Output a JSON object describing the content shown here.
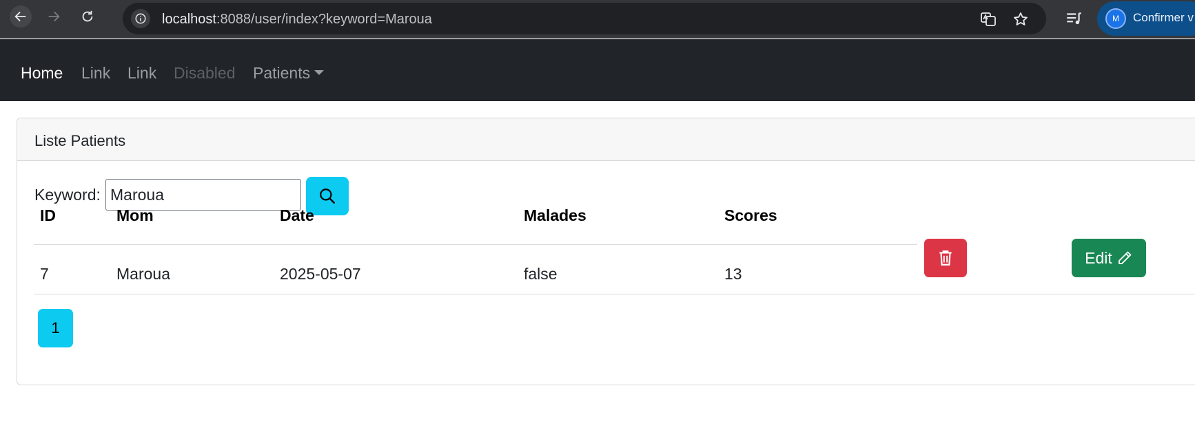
{
  "browser": {
    "url_host": "localhost",
    "url_path": ":8088/user/index?keyword=Maroua",
    "profile_initial": "M",
    "profile_label": "Confirmer v",
    "icons": [
      "back-arrow-icon",
      "forward-arrow-icon",
      "reload-icon",
      "info-icon",
      "translate-icon",
      "star-icon",
      "media-queue-icon"
    ]
  },
  "navbar": {
    "home": "Home",
    "link1": "Link",
    "link2": "Link",
    "disabled": "Disabled",
    "patients": "Patients"
  },
  "card": {
    "title": "Liste Patients"
  },
  "search": {
    "label": "Keyword:",
    "value": "Maroua"
  },
  "table": {
    "headers": [
      "ID",
      "Mom",
      "Date",
      "Malades",
      "Scores"
    ],
    "rows": [
      {
        "id": "7",
        "nom": "Maroua",
        "date": "2025-05-07",
        "malade": "false",
        "score": "13"
      }
    ],
    "edit_label": "Edit"
  },
  "pagination": {
    "pages": [
      "1"
    ]
  },
  "colors": {
    "navbar_bg": "#212529",
    "info": "#0dcaf0",
    "danger": "#dc3545",
    "success": "#198754"
  }
}
